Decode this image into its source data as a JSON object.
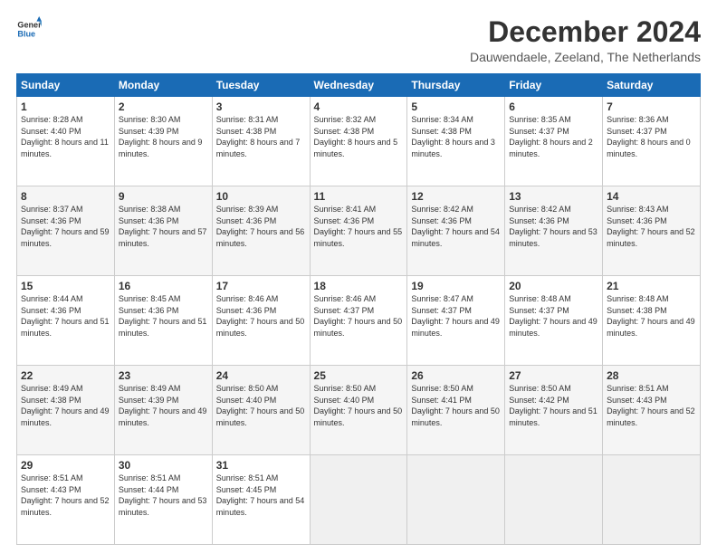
{
  "logo": {
    "line1": "General",
    "line2": "Blue"
  },
  "title": "December 2024",
  "subtitle": "Dauwendaele, Zeeland, The Netherlands",
  "days_of_week": [
    "Sunday",
    "Monday",
    "Tuesday",
    "Wednesday",
    "Thursday",
    "Friday",
    "Saturday"
  ],
  "weeks": [
    [
      {
        "day": "1",
        "sunrise": "8:28 AM",
        "sunset": "4:40 PM",
        "daylight": "8 hours and 11 minutes."
      },
      {
        "day": "2",
        "sunrise": "8:30 AM",
        "sunset": "4:39 PM",
        "daylight": "8 hours and 9 minutes."
      },
      {
        "day": "3",
        "sunrise": "8:31 AM",
        "sunset": "4:38 PM",
        "daylight": "8 hours and 7 minutes."
      },
      {
        "day": "4",
        "sunrise": "8:32 AM",
        "sunset": "4:38 PM",
        "daylight": "8 hours and 5 minutes."
      },
      {
        "day": "5",
        "sunrise": "8:34 AM",
        "sunset": "4:38 PM",
        "daylight": "8 hours and 3 minutes."
      },
      {
        "day": "6",
        "sunrise": "8:35 AM",
        "sunset": "4:37 PM",
        "daylight": "8 hours and 2 minutes."
      },
      {
        "day": "7",
        "sunrise": "8:36 AM",
        "sunset": "4:37 PM",
        "daylight": "8 hours and 0 minutes."
      }
    ],
    [
      {
        "day": "8",
        "sunrise": "8:37 AM",
        "sunset": "4:36 PM",
        "daylight": "7 hours and 59 minutes."
      },
      {
        "day": "9",
        "sunrise": "8:38 AM",
        "sunset": "4:36 PM",
        "daylight": "7 hours and 57 minutes."
      },
      {
        "day": "10",
        "sunrise": "8:39 AM",
        "sunset": "4:36 PM",
        "daylight": "7 hours and 56 minutes."
      },
      {
        "day": "11",
        "sunrise": "8:41 AM",
        "sunset": "4:36 PM",
        "daylight": "7 hours and 55 minutes."
      },
      {
        "day": "12",
        "sunrise": "8:42 AM",
        "sunset": "4:36 PM",
        "daylight": "7 hours and 54 minutes."
      },
      {
        "day": "13",
        "sunrise": "8:42 AM",
        "sunset": "4:36 PM",
        "daylight": "7 hours and 53 minutes."
      },
      {
        "day": "14",
        "sunrise": "8:43 AM",
        "sunset": "4:36 PM",
        "daylight": "7 hours and 52 minutes."
      }
    ],
    [
      {
        "day": "15",
        "sunrise": "8:44 AM",
        "sunset": "4:36 PM",
        "daylight": "7 hours and 51 minutes."
      },
      {
        "day": "16",
        "sunrise": "8:45 AM",
        "sunset": "4:36 PM",
        "daylight": "7 hours and 51 minutes."
      },
      {
        "day": "17",
        "sunrise": "8:46 AM",
        "sunset": "4:36 PM",
        "daylight": "7 hours and 50 minutes."
      },
      {
        "day": "18",
        "sunrise": "8:46 AM",
        "sunset": "4:37 PM",
        "daylight": "7 hours and 50 minutes."
      },
      {
        "day": "19",
        "sunrise": "8:47 AM",
        "sunset": "4:37 PM",
        "daylight": "7 hours and 49 minutes."
      },
      {
        "day": "20",
        "sunrise": "8:48 AM",
        "sunset": "4:37 PM",
        "daylight": "7 hours and 49 minutes."
      },
      {
        "day": "21",
        "sunrise": "8:48 AM",
        "sunset": "4:38 PM",
        "daylight": "7 hours and 49 minutes."
      }
    ],
    [
      {
        "day": "22",
        "sunrise": "8:49 AM",
        "sunset": "4:38 PM",
        "daylight": "7 hours and 49 minutes."
      },
      {
        "day": "23",
        "sunrise": "8:49 AM",
        "sunset": "4:39 PM",
        "daylight": "7 hours and 49 minutes."
      },
      {
        "day": "24",
        "sunrise": "8:50 AM",
        "sunset": "4:40 PM",
        "daylight": "7 hours and 50 minutes."
      },
      {
        "day": "25",
        "sunrise": "8:50 AM",
        "sunset": "4:40 PM",
        "daylight": "7 hours and 50 minutes."
      },
      {
        "day": "26",
        "sunrise": "8:50 AM",
        "sunset": "4:41 PM",
        "daylight": "7 hours and 50 minutes."
      },
      {
        "day": "27",
        "sunrise": "8:50 AM",
        "sunset": "4:42 PM",
        "daylight": "7 hours and 51 minutes."
      },
      {
        "day": "28",
        "sunrise": "8:51 AM",
        "sunset": "4:43 PM",
        "daylight": "7 hours and 52 minutes."
      }
    ],
    [
      {
        "day": "29",
        "sunrise": "8:51 AM",
        "sunset": "4:43 PM",
        "daylight": "7 hours and 52 minutes."
      },
      {
        "day": "30",
        "sunrise": "8:51 AM",
        "sunset": "4:44 PM",
        "daylight": "7 hours and 53 minutes."
      },
      {
        "day": "31",
        "sunrise": "8:51 AM",
        "sunset": "4:45 PM",
        "daylight": "7 hours and 54 minutes."
      },
      null,
      null,
      null,
      null
    ]
  ],
  "labels": {
    "sunrise_prefix": "Sunrise: ",
    "sunset_prefix": "Sunset: ",
    "daylight_prefix": "Daylight: "
  }
}
